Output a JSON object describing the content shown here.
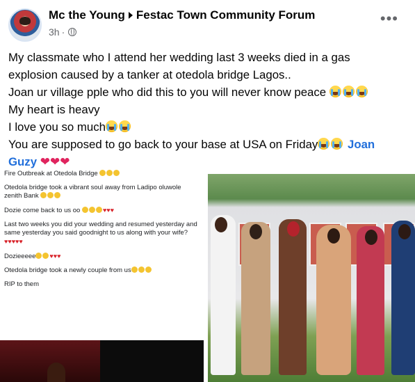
{
  "post": {
    "author": "Mc the Young",
    "group": "Festac Town Community Forum",
    "time": "3h",
    "more_label": "•••",
    "lines": [
      "My classmate who I attend her wedding last 3 weeks died in a gas",
      "explosion caused by a tanker at otedola bridge Lagos..",
      "Joan ur village pple who did this to you will never know peace",
      "My heart is heavy",
      "I love you so much",
      "You are supposed to go back to your base at USA on Friday"
    ],
    "mention": "Joan",
    "mention2": "Guzy"
  },
  "screenshot": {
    "lines": [
      "Fire Outbreak at Otedola Bridge",
      "Otedola bridge took a vibrant soul away from Ladipo oluwole zenith Bank",
      "Dozie come back to us oo",
      "Last two weeks you did your wedding and resumed yesterday and same yesterday you said goodnight to us along with your wife?",
      "Dozieeeee",
      "Otedola bridge took a newly couple from us",
      "RIP to them"
    ]
  },
  "colors": {
    "mention": "#216fdb",
    "meta": "#65676b",
    "heart": "#e0245e"
  }
}
